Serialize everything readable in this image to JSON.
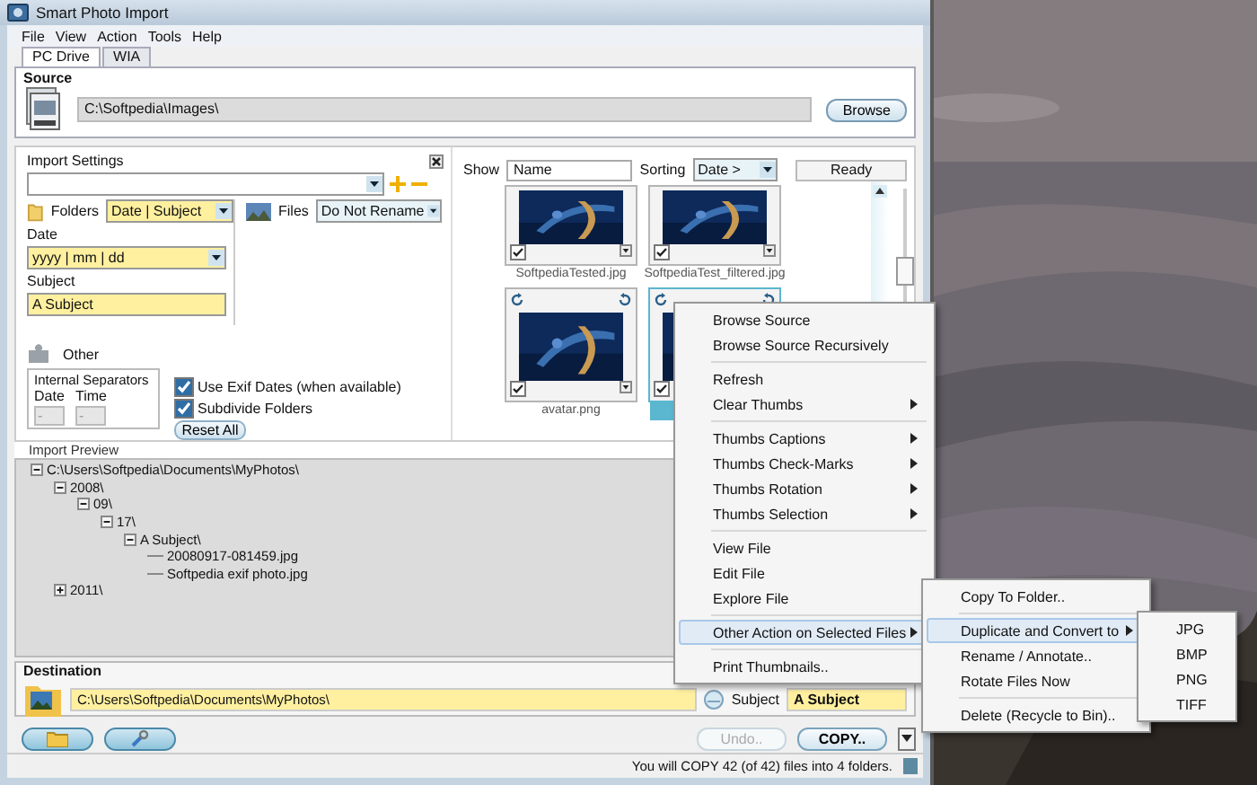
{
  "window": {
    "title": "Smart Photo Import"
  },
  "menu": [
    "File",
    "View",
    "Action",
    "Tools",
    "Help"
  ],
  "tabs": [
    {
      "label": "PC Drive",
      "selected": true
    },
    {
      "label": "WIA",
      "selected": false
    }
  ],
  "source": {
    "label": "Source",
    "path": "C:\\Softpedia\\Images\\",
    "browse": "Browse"
  },
  "import_settings": {
    "label": "Import Settings",
    "folders_label": "Folders",
    "folders": "Date | Subject",
    "files_label": "Files",
    "files": "Do Not Rename",
    "date_label": "Date",
    "date": "yyyy | mm | dd",
    "subject_label": "Subject",
    "subject": "A Subject",
    "other_label": "Other",
    "separators": {
      "label": "Internal Separators",
      "date_label": "Date",
      "date": "-",
      "time_label": "Time",
      "time": "-"
    },
    "checks": [
      {
        "label": "Use Exif Dates (when available)",
        "checked": true
      },
      {
        "label": "Subdivide Folders",
        "checked": true
      }
    ],
    "reset": "Reset All"
  },
  "view": {
    "show_label": "Show",
    "show": "Name",
    "sorting_label": "Sorting",
    "sorting": "Date >",
    "status": "Ready",
    "zoom": {
      "level": 0.65
    }
  },
  "thumbs": [
    {
      "caption": "SoftpediaTested.jpg",
      "checked": true,
      "selected": false,
      "clipped": true,
      "menu_arrow": true
    },
    {
      "caption": "SoftpediaTest_filtered.jpg",
      "checked": true,
      "selected": false,
      "clipped": true,
      "menu_arrow": true
    },
    {
      "caption": "avatar.png",
      "checked": true,
      "selected": false,
      "clipped": false,
      "menu_arrow": true
    },
    {
      "checked": true,
      "selected": true,
      "clipped": false,
      "menu_arrow": false
    }
  ],
  "preview": {
    "label": "Import Preview",
    "tree": [
      {
        "label": "C:\\Users\\Softpedia\\Documents\\MyPhotos\\",
        "expanded": true,
        "children": [
          {
            "label": "2008\\",
            "expanded": true,
            "children": [
              {
                "label": "09\\",
                "expanded": true,
                "children": [
                  {
                    "label": "17\\",
                    "expanded": true,
                    "children": [
                      {
                        "label": "A Subject\\",
                        "expanded": true,
                        "children": [
                          {
                            "label": "20080917-081459.jpg"
                          },
                          {
                            "label": "Softpedia exif photo.jpg"
                          }
                        ]
                      }
                    ]
                  }
                ]
              }
            ]
          },
          {
            "label": "2011\\",
            "expanded": false
          }
        ]
      }
    ]
  },
  "destination": {
    "label": "Destination",
    "path": "C:\\Users\\Softpedia\\Documents\\MyPhotos\\",
    "subject_label": "Subject",
    "subject": "A Subject"
  },
  "actions": {
    "undo": {
      "label": "Undo..",
      "disabled": true
    },
    "copy": "COPY.."
  },
  "status_bar": "You will COPY 42 (of 42) files into 4 folders.",
  "context_menu": [
    [
      {
        "label": "Browse Source",
        "submenu": false,
        "selected": false
      },
      {
        "label": "Browse Source Recursively",
        "submenu": false,
        "selected": false
      }
    ],
    [
      {
        "label": "Refresh",
        "submenu": false,
        "selected": false
      },
      {
        "label": "Clear Thumbs",
        "submenu": true,
        "selected": false
      }
    ],
    [
      {
        "label": "Thumbs Captions",
        "submenu": true,
        "selected": false
      },
      {
        "label": "Thumbs Check-Marks",
        "submenu": true,
        "selected": false
      },
      {
        "label": "Thumbs Rotation",
        "submenu": true,
        "selected": false
      },
      {
        "label": "Thumbs Selection",
        "submenu": true,
        "selected": false
      }
    ],
    [
      {
        "label": "View File",
        "submenu": false,
        "selected": false
      },
      {
        "label": "Edit File",
        "submenu": false,
        "selected": false
      },
      {
        "label": "Explore File",
        "submenu": false,
        "selected": false
      }
    ],
    [
      {
        "label": "Other Action on Selected Files",
        "submenu": true,
        "selected": true
      }
    ],
    [
      {
        "label": "Print Thumbnails..",
        "submenu": false,
        "selected": false
      }
    ]
  ],
  "submenu": [
    [
      {
        "label": "Copy To Folder..",
        "submenu": false,
        "selected": false
      }
    ],
    [
      {
        "label": "Duplicate and Convert to",
        "submenu": true,
        "selected": true
      },
      {
        "label": "Rename / Annotate..",
        "submenu": false,
        "selected": false
      },
      {
        "label": "Rotate Files Now",
        "submenu": false,
        "selected": false
      }
    ],
    [
      {
        "label": "Delete (Recycle to Bin)..",
        "submenu": false,
        "selected": false
      }
    ]
  ],
  "convert_menu": [
    [
      {
        "label": "JPG",
        "submenu": false,
        "selected": false
      },
      {
        "label": "BMP",
        "submenu": false,
        "selected": false
      },
      {
        "label": "PNG",
        "submenu": false,
        "selected": false
      },
      {
        "label": "TIFF",
        "submenu": false,
        "selected": false
      }
    ]
  ]
}
